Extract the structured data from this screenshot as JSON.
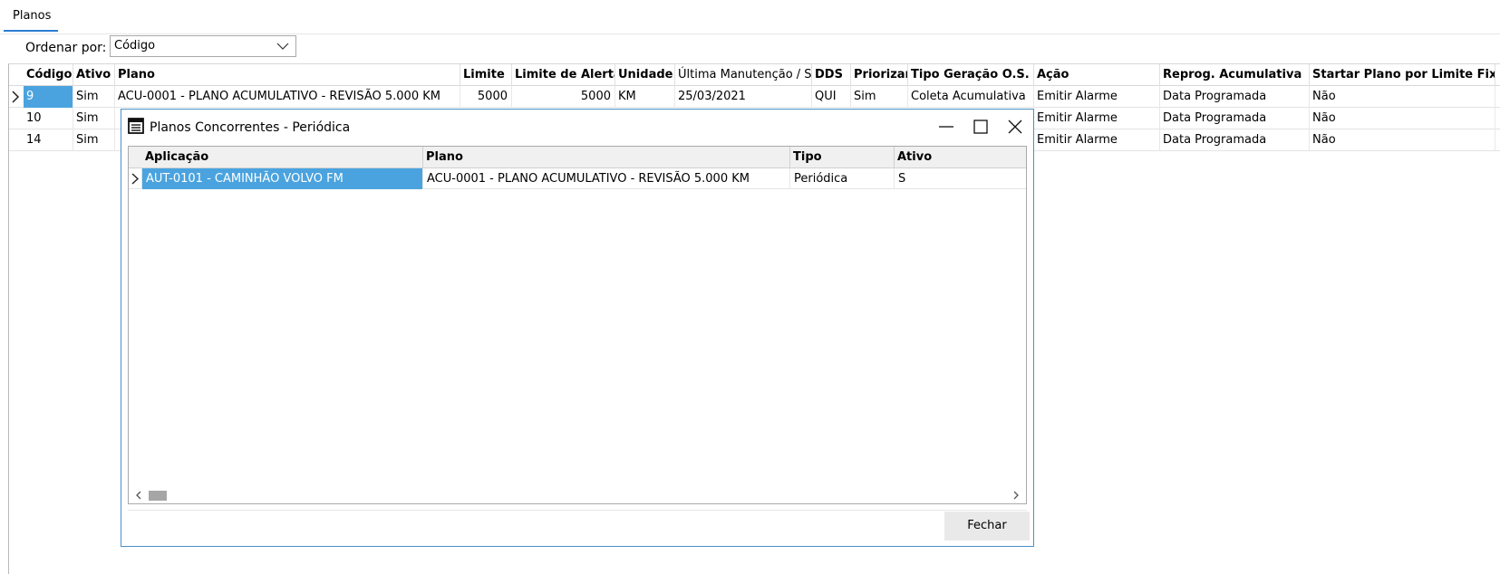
{
  "tab": {
    "label": "Planos",
    "accent": "#2b7cd3"
  },
  "order": {
    "label": "Ordenar por:",
    "value": "Código"
  },
  "grid": {
    "columns": [
      "Código",
      "Ativo",
      "Plano",
      "Limite",
      "Limite de Alerta",
      "Unidade",
      "Última Manutenção / Star",
      "DDS",
      "Priorizar",
      "Tipo Geração O.S.",
      "Ação",
      "Reprog. Acumulativa",
      "Startar Plano por Limite Fixo"
    ],
    "rows": [
      {
        "codigo": "9",
        "ativo": "Sim",
        "plano": "ACU-0001 - PLANO ACUMULATIVO - REVISÃO 5.000 KM",
        "limite": "5000",
        "alerta": "5000",
        "unidade": "KM",
        "ultima": "25/03/2021",
        "dds": "QUI",
        "priorizar": "Sim",
        "tipo": "Coleta Acumulativa",
        "acao": "Emitir Alarme",
        "reprog": "Data Programada",
        "startar": "Não"
      },
      {
        "codigo": "10",
        "ativo": "Sim",
        "acao": "Emitir Alarme",
        "reprog": "Data Programada",
        "startar": "Não"
      },
      {
        "codigo": "14",
        "ativo": "Sim",
        "acao": "Emitir Alarme",
        "reprog": "Data Programada",
        "startar": "Não"
      }
    ],
    "selection_color": "#4aa3df"
  },
  "dialog": {
    "title": "Planos Concorrentes - Periódica",
    "icon": "list-window-icon",
    "columns": [
      "Aplicação",
      "Plano",
      "Tipo",
      "Ativo"
    ],
    "rows": [
      {
        "aplicacao": "AUT-0101 - CAMINHÃO VOLVO FM",
        "plano": "ACU-0001 - PLANO ACUMULATIVO - REVISÃO 5.000 KM",
        "tipo": "Periódica",
        "ativo": "S"
      }
    ],
    "close_button": "Fechar",
    "border_color": "#4a90c8"
  }
}
